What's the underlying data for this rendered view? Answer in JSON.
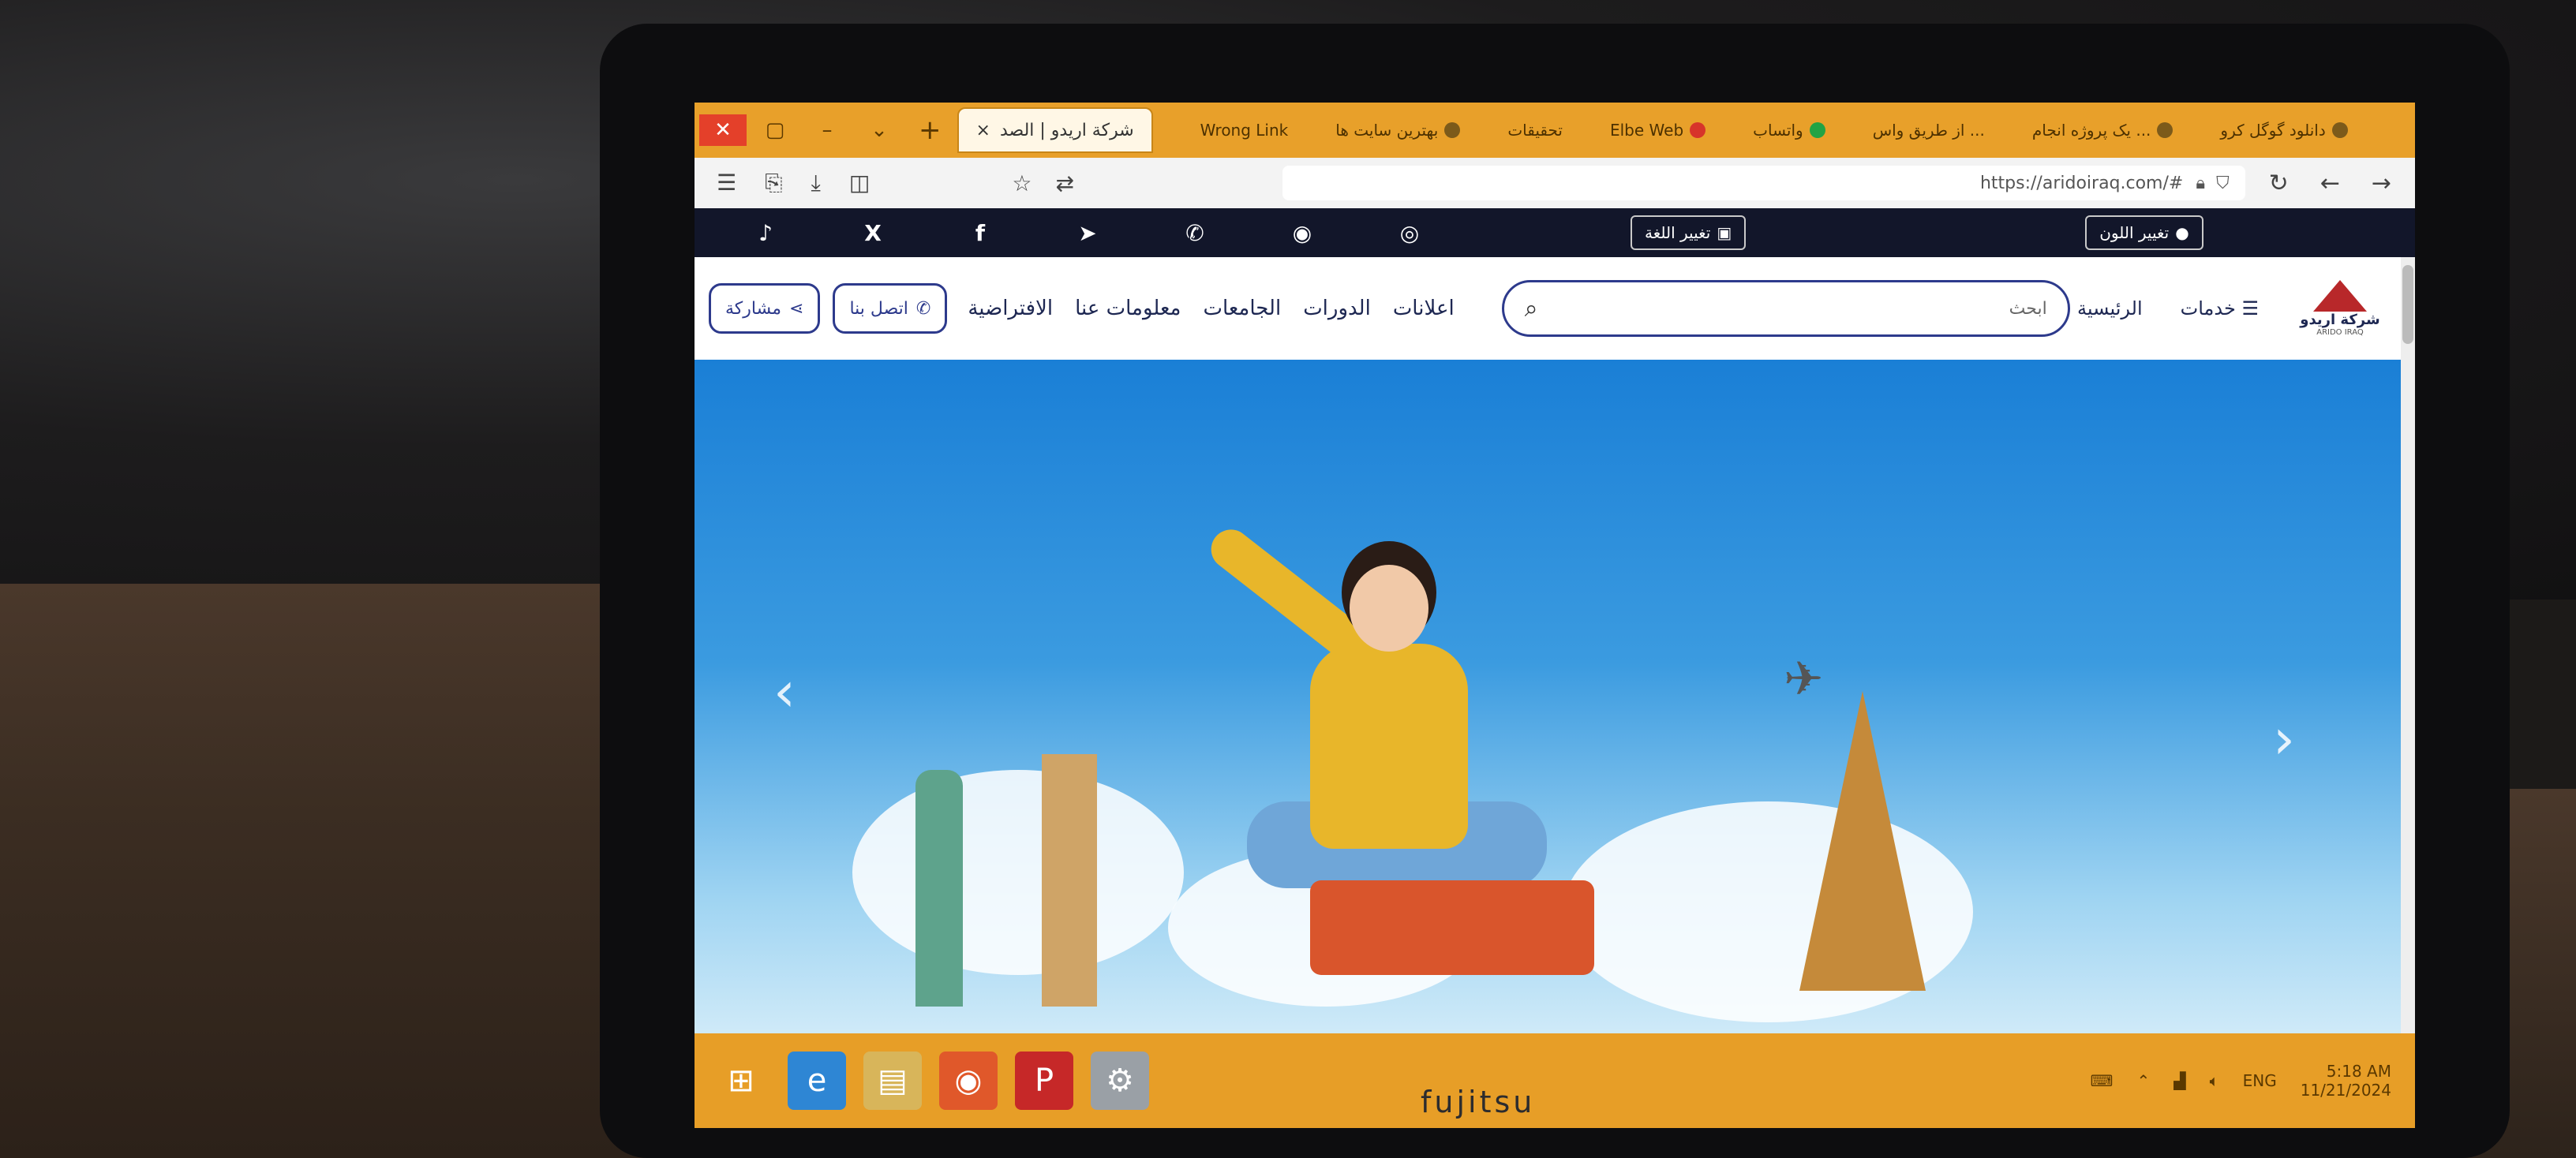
{
  "browser": {
    "tab_title": "شركة اريدو | الصد",
    "tab_close": "×",
    "new_tab": "+",
    "bookmarks": [
      {
        "label": "Wrong Link"
      },
      {
        "label": "بهترین سایت ها"
      },
      {
        "label": "تحقیقات"
      },
      {
        "label": "Elbe Web"
      },
      {
        "label": "واتساب"
      },
      {
        "label": "از طریق واس ..."
      },
      {
        "label": "یک پروژه انجام ..."
      },
      {
        "label": "دانلود گوگل کرو"
      }
    ],
    "url": "https://aridoiraq.com/#"
  },
  "socialbar": {
    "icons": [
      {
        "name": "tiktok",
        "glyph": "♪"
      },
      {
        "name": "x",
        "glyph": "X"
      },
      {
        "name": "facebook",
        "glyph": "f"
      },
      {
        "name": "telegram",
        "glyph": "➤"
      },
      {
        "name": "whatsapp",
        "glyph": "✆"
      },
      {
        "name": "android",
        "glyph": "◉"
      },
      {
        "name": "instagram",
        "glyph": "◎"
      }
    ],
    "change_language": "تغيير اللغة",
    "change_color": "تغيير اللون"
  },
  "siteheader": {
    "share": "مشاركة",
    "contact": "اتصل بنا",
    "menu": [
      "الافتراضية",
      "معلومات عنا",
      "الجامعات",
      "الدورات",
      "اعلانات"
    ],
    "search_placeholder": "ابحث",
    "home": "الرئيسية",
    "services": "خدمات",
    "logo_text": "شركة اريدو",
    "logo_sub": "ARIDO IRAQ"
  },
  "hero": {
    "prev": "‹",
    "next": "›"
  },
  "taskbar": {
    "lang": "ENG",
    "time": "5:18 AM",
    "date": "11/21/2024"
  },
  "colors": {
    "browser_accent": "#e8a02a",
    "social_bar": "#12162a",
    "brand_blue": "#2d3a8c"
  }
}
